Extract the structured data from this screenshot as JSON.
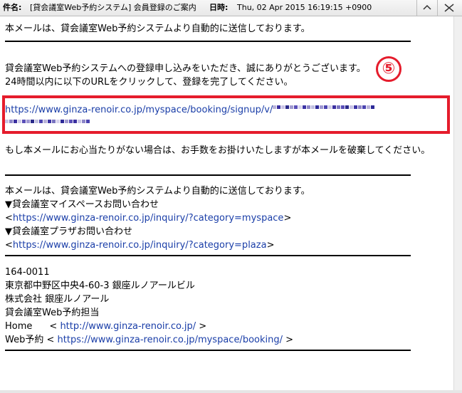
{
  "header": {
    "subject_label": "件名:",
    "subject_value": "[貸会議室Web予約システム] 会員登録のご案内",
    "date_label": "日時:",
    "date_value": "Thu, 02 Apr 2015 16:19:15 +0900"
  },
  "annotation": {
    "step_number": "⑤"
  },
  "email": {
    "auto_notice": "本メールは、貸会議室Web予約システムより自動的に送信しております。",
    "thanks": "貸会議室Web予約システムへの登録申し込みをいただき、誠にありがとうございます。",
    "instruction": "24時間以内に以下のURLをクリックして、登録を完了してください。",
    "signup_url": "https://www.ginza-renoir.co.jp/myspace/booking/signup/v/",
    "discard_notice": "もし本メールにお心当たりがない場合は、お手数をお掛けいたしますが本メールを破棄してください。",
    "footer": {
      "auto_notice": "本メールは、貸会議室Web予約システムより自動的に送信しております。",
      "myspace_contact_title": "▼貸会議室マイスペースお問い合わせ",
      "myspace_contact_url": "https://www.ginza-renoir.co.jp/inquiry/?category=myspace",
      "plaza_contact_title": "▼貸会議室プラザお問い合わせ",
      "plaza_contact_url": "https://www.ginza-renoir.co.jp/inquiry/?category=plaza",
      "lt": "<",
      "gt": ">"
    },
    "signature": {
      "postal_code": "164-0011",
      "address": "東京都中野区中央4-60-3 銀座ルノアールビル",
      "company": "株式会社 銀座ルノアール",
      "department": "貸会議室Web予約担当",
      "home_label": "Home",
      "home_url": "http://www.ginza-renoir.co.jp/",
      "web_label": "Web予約",
      "web_url": "https://www.ginza-renoir.co.jp/myspace/booking/"
    }
  },
  "colors": {
    "highlight": "#e51c2c",
    "link": "#1a3ea8"
  }
}
